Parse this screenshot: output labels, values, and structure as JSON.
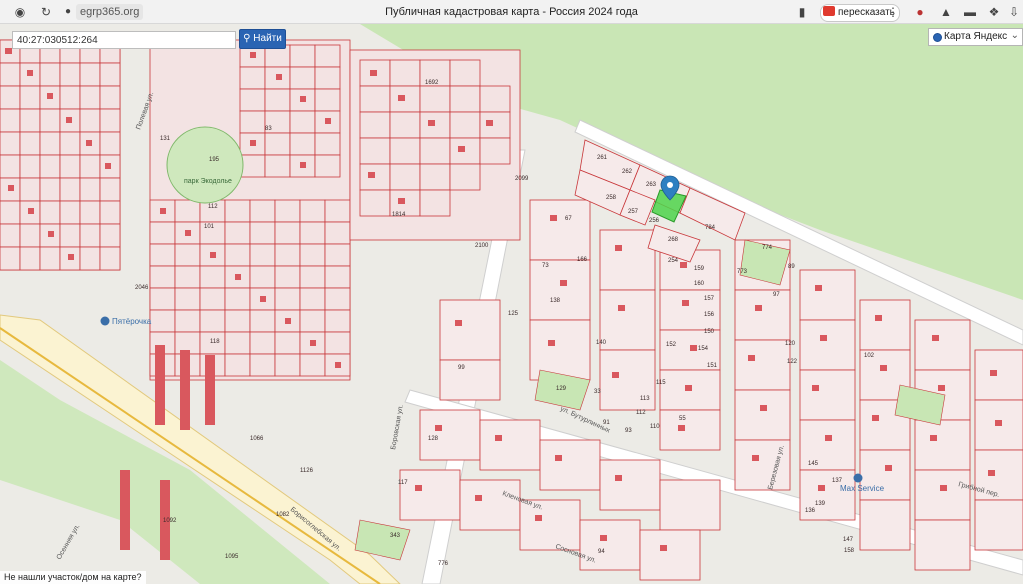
{
  "browser": {
    "url": "egrp365.org",
    "page_title": "Публичная кадастровая карта - Россия 2024 года",
    "retell_label": "пересказать",
    "more_label": "⋮"
  },
  "search": {
    "value": "40:27:030512:264",
    "button_label": "Найти"
  },
  "layer": {
    "selected": "Карта Яндекс"
  },
  "feedback_label": "Не нашли участок/дом на карте?",
  "colors": {
    "parcel_stroke": "#c8373a",
    "building": "#d9585e",
    "selected_parcel": "#4ed34a",
    "green_area": "#c8e6b4",
    "marker": "#2e7fc1"
  },
  "map": {
    "streets": [
      "Полевая ул.",
      "Борисоглебская ул.",
      "Боровская ул.",
      "ул. Бутурлинных",
      "Кленовая ул.",
      "Сосновая ул.",
      "Березовая ул.",
      "Грибной пер.",
      "Осенняя ул."
    ],
    "pois": [
      "Пятёрочка",
      "Max Service"
    ],
    "parks": [
      "парк Экодолье"
    ],
    "parcel_numbers": [
      "261",
      "262",
      "263",
      "258",
      "257",
      "256",
      "784",
      "268",
      "774",
      "254",
      "159",
      "773",
      "89",
      "160",
      "157",
      "156",
      "150",
      "154",
      "152",
      "120",
      "122",
      "115",
      "113",
      "112",
      "110",
      "93",
      "91",
      "129",
      "99",
      "94",
      "2100",
      "2099",
      "2046",
      "1692",
      "1814",
      "1126",
      "1066",
      "1092",
      "1095",
      "1082",
      "343",
      "776",
      "195",
      "131",
      "83",
      "112",
      "101",
      "118",
      "125",
      "33",
      "55",
      "128",
      "67",
      "73",
      "166",
      "138",
      "140",
      "117",
      "151",
      "97",
      "102",
      "137",
      "145",
      "136",
      "147",
      "139",
      "158"
    ]
  }
}
